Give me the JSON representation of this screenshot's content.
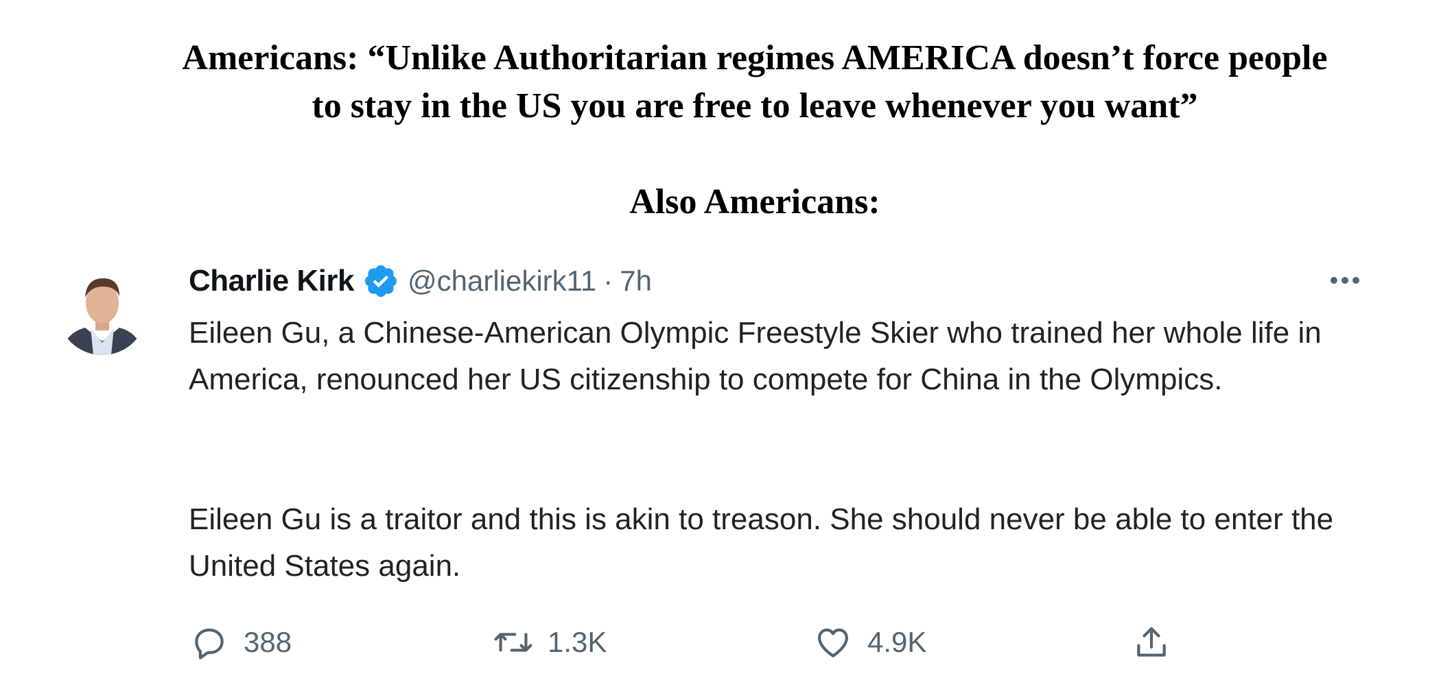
{
  "meme": {
    "caption_line1": "Americans: “Unlike Authoritarian regimes AMERICA doesn’t force people",
    "caption_line2": "to stay in the US you are free to leave whenever you want”",
    "caption_line3": "Also Americans:"
  },
  "tweet": {
    "author_name": "Charlie Kirk",
    "handle": "@charliekirk11",
    "separator": "·",
    "time": "7h",
    "paragraph1": "Eileen Gu, a Chinese-American Olympic Freestyle Skier who trained her whole life in America, renounced her US citizenship to compete for China in the Olympics.",
    "paragraph2": "Eileen Gu is a traitor and this is akin to treason. She should never be able to enter the United States again.",
    "replies": "388",
    "retweets": "1.3K",
    "likes": "4.9K",
    "verified_color": "#1d9bf0",
    "icon_color": "#536471"
  }
}
